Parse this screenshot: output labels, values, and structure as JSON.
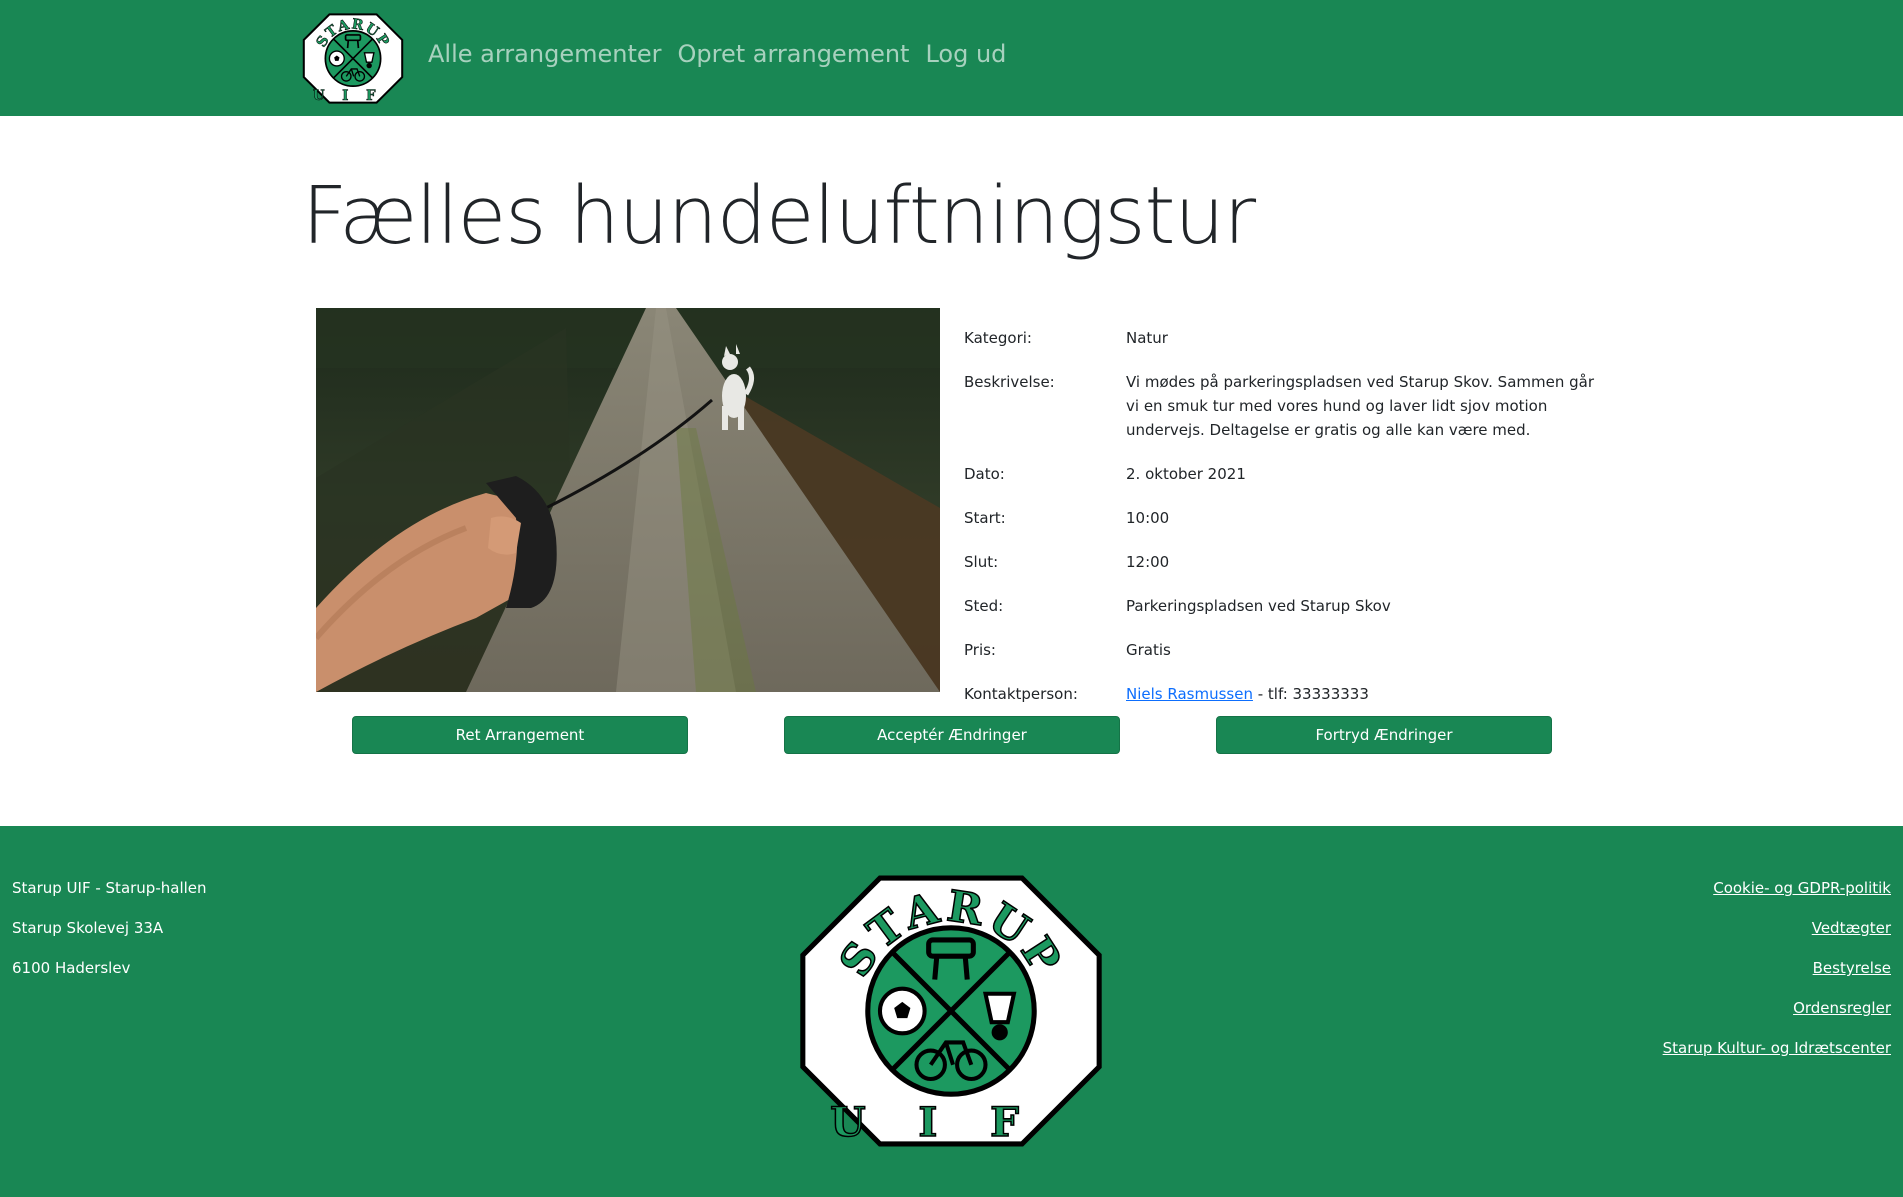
{
  "nav": {
    "logo_top": "STARUP",
    "logo_bottom": "UIF",
    "links": [
      "Alle arrangementer",
      "Opret arrangement",
      "Log ud"
    ]
  },
  "event": {
    "title": "Fælles hundeluftningstur",
    "details": {
      "category_label": "Kategori:",
      "category": "Natur",
      "description_label": "Beskrivelse:",
      "description": "Vi mødes på parkeringspladsen ved Starup Skov. Sammen går vi en smuk tur med vores hund og laver lidt sjov motion undervejs. Deltagelse er gratis og alle kan være med.",
      "date_label": "Dato:",
      "date": "2. oktober 2021",
      "start_label": "Start:",
      "start": "10:00",
      "end_label": "Slut:",
      "end": "12:00",
      "place_label": "Sted:",
      "place": "Parkeringspladsen ved Starup Skov",
      "price_label": "Pris:",
      "price": "Gratis",
      "contact_label": "Kontaktperson:",
      "contact_name": "Niels Rasmussen",
      "contact_phone": " - tlf: 33333333"
    }
  },
  "actions": {
    "edit": "Ret Arrangement",
    "accept": "Acceptér Ændringer",
    "cancel": "Fortryd Ændringer"
  },
  "footer": {
    "address": [
      "Starup UIF - Starup-hallen",
      "Starup Skolevej 33A",
      "6100 Haderslev"
    ],
    "links": [
      "Cookie- og GDPR-politik",
      "Vedtægter",
      "Bestyrelse",
      "Ordensregler",
      "Starup Kultur- og Idrætscenter"
    ]
  },
  "colors": {
    "brand_green": "#198754",
    "link_blue": "#0d6efd"
  },
  "icons": {
    "logo": "starup-uif-logo",
    "photo": "dog-walk-photo"
  }
}
